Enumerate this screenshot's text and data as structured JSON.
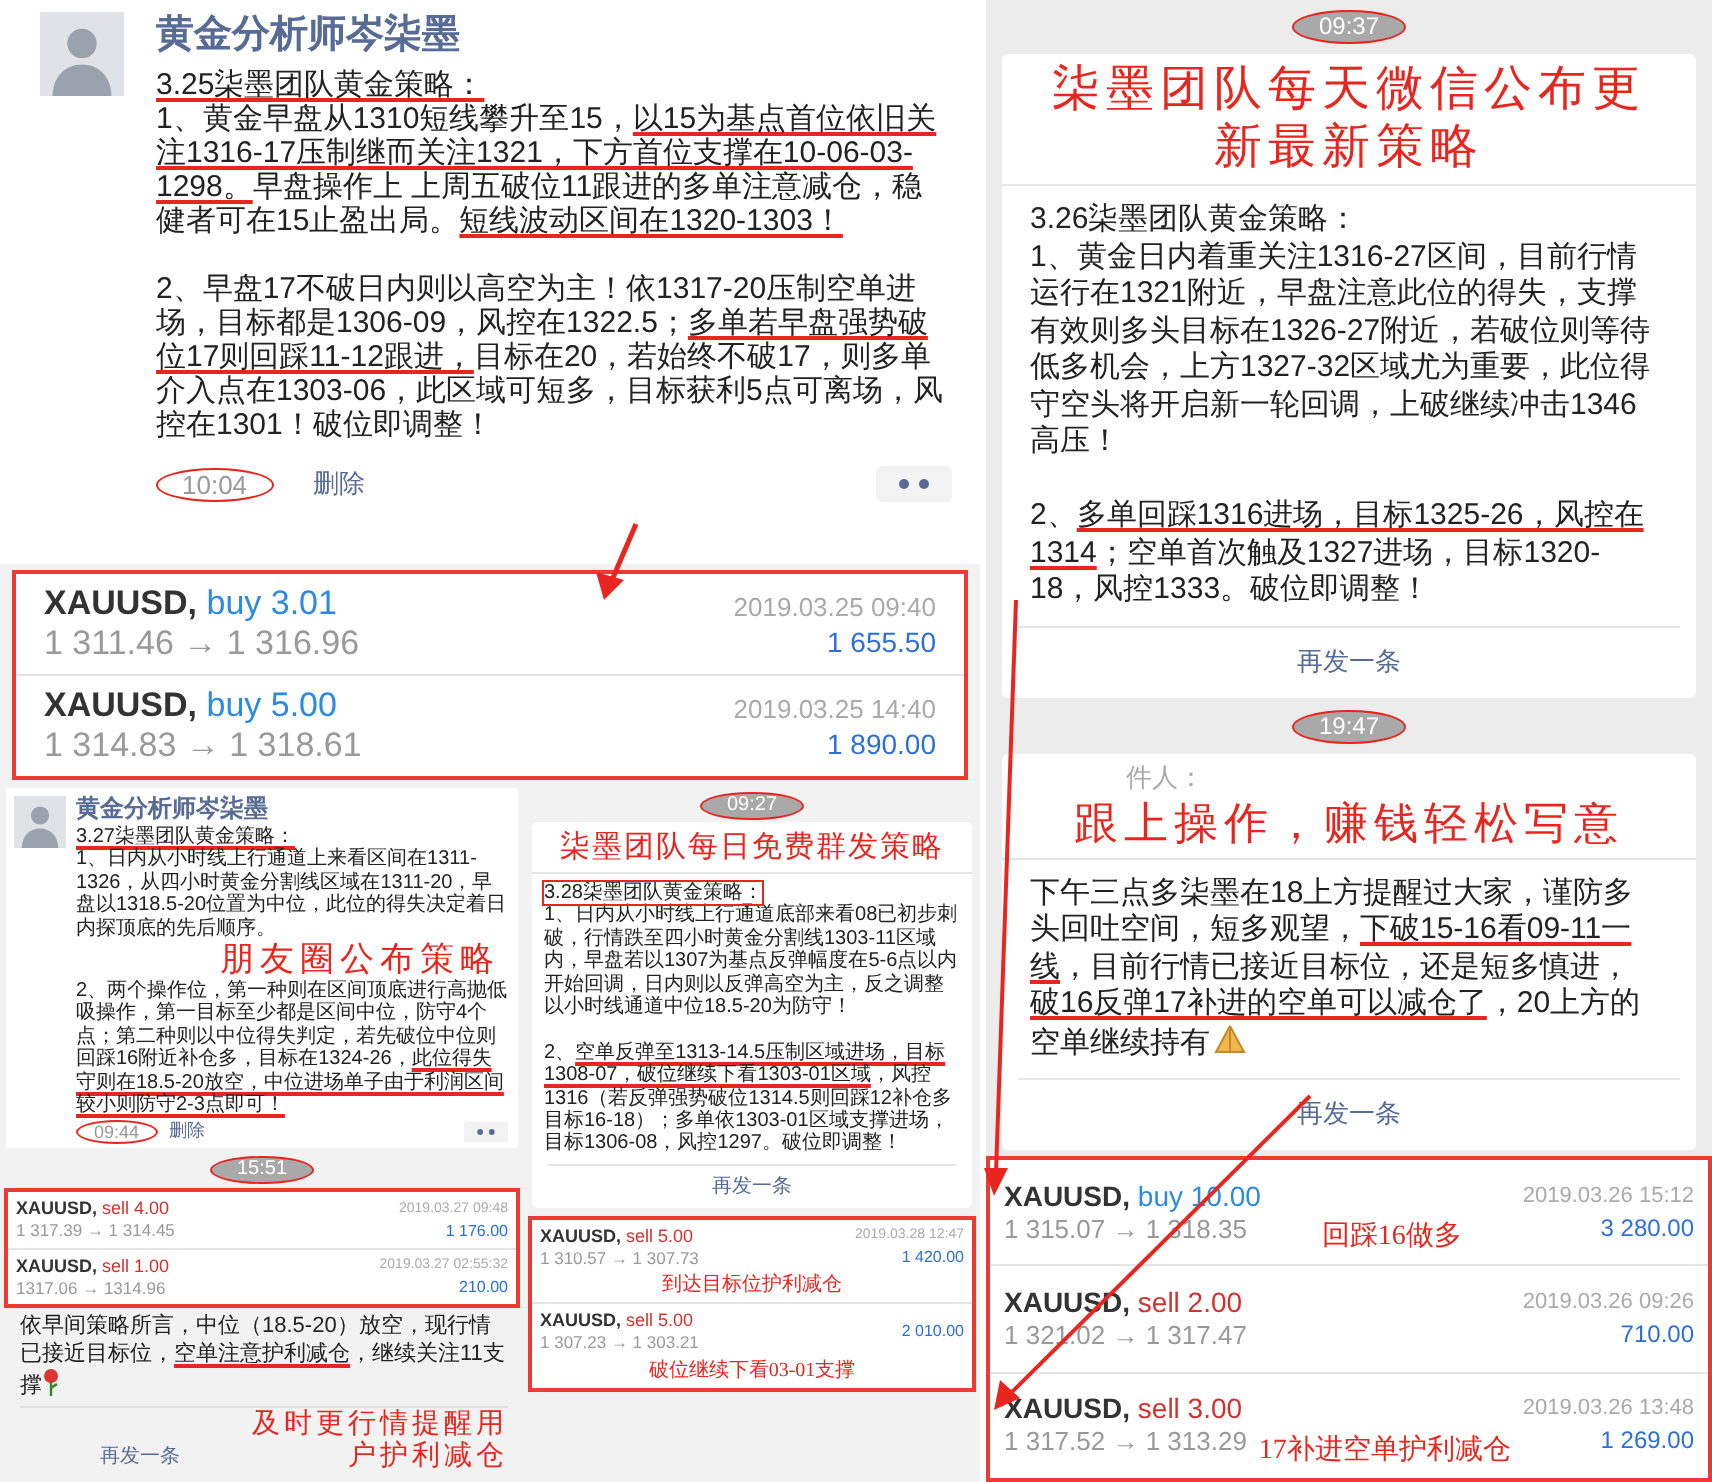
{
  "post_325": {
    "author": "黄金分析师岑柒墨",
    "heading": {
      "text": "3.25柒墨团队黄金策略：",
      "underlined": true
    },
    "points": [
      [
        {
          "text": "1、黄金早盘从1310短线攀升至15，",
          "underlined": false
        },
        {
          "text": "以15为基点首位依旧关注1316-17压制继而关注1321，下方首位支撑在10-06-03-1298。",
          "underlined": true
        },
        {
          "text": "早盘操作上 上周五破位11跟进的多单注意减仓，稳健者可在15止盈出局。",
          "underlined": false
        },
        {
          "text": "短线波动区间在1320-1303！",
          "underlined": true
        }
      ],
      [
        {
          "text": "2、早盘17不破日内则以高空为主！依1317-20压制空单进场，目标都是1306-09，风控在1322.5；",
          "underlined": false
        },
        {
          "text": "多单若早盘强势破位17则回踩11-12跟进，",
          "underlined": true
        },
        {
          "text": "目标在20，若始终不破17，则多单介入点在1303-06，此区域可短多，目标获利5点可离场，风控在1301！破位即调整！",
          "underlined": false
        }
      ]
    ],
    "time": {
      "text": "10:04",
      "circled": true
    },
    "action": "删除"
  },
  "trades_325": [
    {
      "symbol": "XAUUSD,",
      "order": "buy 3.01",
      "color": "#2c8ae0",
      "prices": "1 311.46 → 1 316.96",
      "time": "2019.03.25 09:40",
      "profit": "1 655.50"
    },
    {
      "symbol": "XAUUSD,",
      "order": "buy 5.00",
      "color": "#2c8ae0",
      "prices": "1 314.83 → 1 318.61",
      "time": "2019.03.25 14:40",
      "profit": "1 890.00"
    }
  ],
  "post_327": {
    "author": "黄金分析师岑柒墨",
    "heading": {
      "text": "3.27柒墨团队黄金策略：",
      "underlined": true
    },
    "points": [
      [
        {
          "text": "1、日内从小时线上行通道上来看区间在1311-1326，从四小时黄金分割线区域在1311-20，早盘以1318.5-20位置为中位，此位的得失决定着日内探顶底的先后顺序。",
          "underlined": false
        }
      ],
      [
        {
          "text": "2、两个操作位，第一种则在区间顶底进行高抛低吸操作，第一目标至少都是区间中位，防守4个点；第二种则以中位得失判定，若先破位中位则回踩16附近补仓多，目标在1324-26，",
          "underlined": false
        },
        {
          "text": "此位得失守则在18.5-20放空，中位进场单子由于利润区间较小则防守2-3点即可！",
          "underlined": true
        }
      ]
    ],
    "callout": "朋友圈公布策略",
    "time": {
      "text": "09:44",
      "circled": true
    },
    "action": "删除"
  },
  "time_327": {
    "text": "15:51",
    "circled": true
  },
  "trades_327": [
    {
      "symbol": "XAUUSD,",
      "order": "sell 4.00",
      "color": "#d3312e",
      "prices": "1 317.39 → 1 314.45",
      "time": "2019.03.27 09:48",
      "profit": "1 176.00"
    },
    {
      "symbol": "XAUUSD,",
      "order": "sell 1.00",
      "color": "#d3312e",
      "prices": "1317.06 → 1314.96",
      "time": "2019.03.27 02:55:32",
      "profit": "210.00"
    }
  ],
  "note_327": {
    "segments": [
      {
        "text": "依早间策略所言，中位（18.5-20）放空，现行情已接近目标位，",
        "underlined": false
      },
      {
        "text": "空单注意护利减仓",
        "underlined": true
      },
      {
        "text": "，继续关注11支撑",
        "underlined": false
      }
    ],
    "callout": "及时更行情提醒用户护利减仓",
    "resend": "再发一条"
  },
  "time_328": {
    "text": "09:27",
    "circled": true
  },
  "card_328": {
    "callout": "柒墨团队每日免费群发策略",
    "heading": {
      "text": "3.28柒墨团队黄金策略：",
      "boxed": true
    },
    "points": [
      [
        {
          "text": "1、日内从小时线上行通道底部来看08已初步刺破，行情跌至四小时黄金分割线1303-11区域内，早盘若以1307为基点反弹幅度在5-6点以内开始回调，日内则以反弹高空为主，反之调整以小时线通道中位18.5-20为防守！",
          "underlined": false
        }
      ],
      [
        {
          "text": "2、",
          "underlined": false
        },
        {
          "text": "空单反弹至1313-14.5压制区域进场，目标1308-07，破位继续下看1303-01区域",
          "underlined": true
        },
        {
          "text": "，风控1316（若反弹强势破位1314.5则回踩12补仓多目标16-18）；多单依1303-01区域支撑进场，目标1306-08，风控1297。破位即调整！",
          "underlined": false
        }
      ]
    ],
    "resend": "再发一条"
  },
  "trades_328": [
    {
      "symbol": "XAUUSD,",
      "order": "sell 5.00",
      "color": "#d3312e",
      "prices": "1 310.57 → 1 307.73",
      "time": "2019.03.28 12:47",
      "profit": "1 420.00",
      "note": "到达目标位护利减仓"
    },
    {
      "symbol": "XAUUSD,",
      "order": "sell 5.00",
      "color": "#d3312e",
      "prices": "1 307.23 → 1 303.21",
      "profit": "2 010.00",
      "note": "破位继续下看03-01支撑"
    }
  ],
  "time_326": {
    "text": "09:37",
    "circled": true
  },
  "card_326": {
    "callout": "柒墨团队每天微信公布更新最新策略",
    "heading": {
      "text": "3.26柒墨团队黄金策略：",
      "underlined": false
    },
    "points": [
      [
        {
          "text": "1、黄金日内着重关注1316-27区间，目前行情运行在1321附近，早盘注意此位的得失，支撑有效则多头目标在1326-27附近，若破位则等待低多机会，上方1327-32区域尤为重要，此位得守空头将开启新一轮回调，上破继续冲击1346高压！",
          "underlined": false
        }
      ],
      [
        {
          "text": "2、",
          "underlined": false
        },
        {
          "text": "多单回踩1316进场，目标1325-26，风控在1314",
          "underlined": true
        },
        {
          "text": "；空单首次触及1327进场，目标1320-18，风控1333。破位即调整！",
          "underlined": false
        }
      ]
    ],
    "resend": "再发一条"
  },
  "time_forward": {
    "text": "19:47",
    "circled": true
  },
  "card_forward": {
    "sender": "件人：",
    "callout": "跟上操作，赚钱轻松写意",
    "points": [
      [
        {
          "text": "下午三点多柒墨在18上方提醒过大家，谨防多头回吐空间，短多观望，",
          "underlined": false
        },
        {
          "text": "下破15-16看09-11一线",
          "underlined": true
        },
        {
          "text": "，目前行情已接近目标位，还是短多慎进，",
          "underlined": false
        },
        {
          "text": "破16反弹17补进的空单可以减仓了",
          "underlined": true
        },
        {
          "text": "，20上方的空单继续持有",
          "underlined": false
        }
      ]
    ],
    "resend": "再发一条"
  },
  "trades_326": [
    {
      "symbol": "XAUUSD,",
      "order": "buy 10.00",
      "color": "#2c8ae0",
      "prices": "1 315.07 → 1 318.35",
      "time": "2019.03.26 15:12",
      "profit": "3 280.00",
      "note": "回踩16做多"
    },
    {
      "symbol": "XAUUSD,",
      "order": "sell 2.00",
      "color": "#d3312e",
      "prices": "1 321.02 → 1 317.47",
      "time": "2019.03.26 09:26",
      "profit": "710.00"
    },
    {
      "symbol": "XAUUSD,",
      "order": "sell 3.00",
      "color": "#d3312e",
      "prices": "1 317.52 → 1 313.29",
      "time": "2019.03.26 13:48",
      "profit": "1 269.00",
      "note": "17补进空单护利减仓"
    }
  ]
}
